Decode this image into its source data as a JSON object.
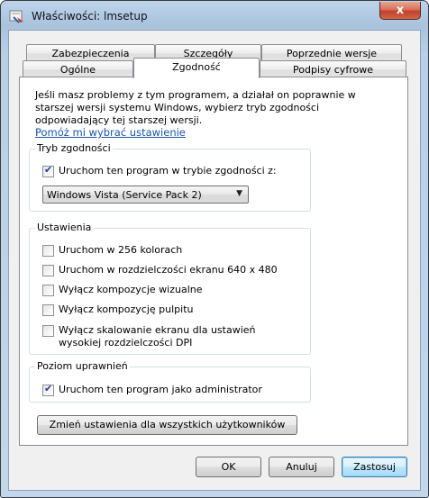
{
  "window": {
    "title": "Właściwości: lmsetup",
    "close_glyph": "x"
  },
  "tabs": {
    "row_top": [
      {
        "label": "Zabezpieczenia"
      },
      {
        "label": "Szczegóły"
      },
      {
        "label": "Poprzednie wersje"
      }
    ],
    "row_bottom": [
      {
        "label": "Ogólne"
      },
      {
        "label": "Zgodność",
        "active": true
      },
      {
        "label": "Podpisy cyfrowe"
      }
    ]
  },
  "panel": {
    "intro_text": "Jeśli masz problemy z tym programem, a działał on poprawnie w starszej wersji systemu Windows, wybierz tryb zgodności odpowiadający tej starszej wersji.",
    "help_link": "Pomóż mi wybrać ustawienie",
    "compat_mode": {
      "title": "Tryb zgodności",
      "checkbox_label": "Uruchom ten program w trybie zgodności z:",
      "checked": true,
      "selected_os": "Windows Vista (Service Pack 2)"
    },
    "settings": {
      "title": "Ustawienia",
      "items": [
        {
          "label": "Uruchom w 256 kolorach",
          "checked": false
        },
        {
          "label": "Uruchom w rozdzielczości ekranu 640 x 480",
          "checked": false
        },
        {
          "label": "Wyłącz kompozycje wizualne",
          "checked": false
        },
        {
          "label": "Wyłącz kompozycję pulpitu",
          "checked": false
        },
        {
          "label": "Wyłącz skalowanie ekranu dla ustawień wysokiej rozdzielczości DPI",
          "checked": false
        }
      ]
    },
    "privilege": {
      "title": "Poziom uprawnień",
      "checkbox_label": "Uruchom ten program jako administrator",
      "checked": true
    },
    "all_users_button": "Zmień ustawienia dla wszystkich użytkowników"
  },
  "footer": {
    "ok": "OK",
    "cancel": "Anuluj",
    "apply": "Zastosuj"
  },
  "colors": {
    "link": "#1a55a8",
    "checkmark": "#1f3e9b",
    "close_button": "#c1402a"
  }
}
